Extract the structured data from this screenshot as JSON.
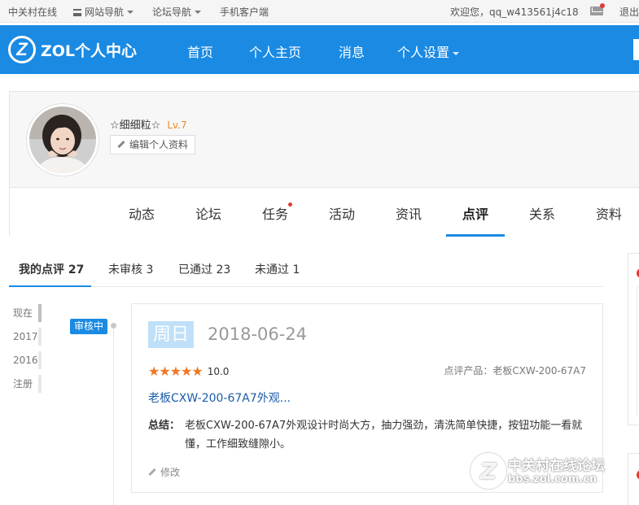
{
  "topbar": {
    "site": "中关村在线",
    "site_nav": "网站导航",
    "forum_nav": "论坛导航",
    "mobile": "手机客户端",
    "welcome": "欢迎您，qq_w413561j4c18",
    "logout": "退出"
  },
  "header": {
    "logo_letter": "Z",
    "logo_text": "ZOL个人中心",
    "nav": [
      "首页",
      "个人主页",
      "消息",
      "个人设置"
    ]
  },
  "profile": {
    "username": "☆细细粒☆",
    "level": "Lv.7",
    "edit_label": "编辑个人资料",
    "tabs": [
      "动态",
      "论坛",
      "任务",
      "活动",
      "资讯",
      "点评",
      "关系",
      "资料"
    ],
    "active_tab": "点评"
  },
  "review_tabs": [
    {
      "label": "我的点评",
      "count": "27"
    },
    {
      "label": "未审核",
      "count": "3"
    },
    {
      "label": "已通过",
      "count": "23"
    },
    {
      "label": "未通过",
      "count": "1"
    }
  ],
  "timeline": [
    "现在",
    "2017",
    "2016",
    "注册"
  ],
  "review": {
    "status": "审核中",
    "weekday": "周日",
    "date": "2018-06-24",
    "stars": "★★★★★",
    "score": "10.0",
    "product": "点评产品：老板CXW-200-67A7",
    "title": "老板CXW-200-67A7外观...",
    "summary_label": "总结：",
    "summary_text": "老板CXW-200-67A7外观设计时尚大方，抽力强劲，清洗简单快捷，按钮功能一看就懂，工作细致缝隙小。",
    "edit": "修改"
  },
  "watermark": {
    "line1": "中关村在线论坛",
    "line2": "bbs.zol.com.cn"
  },
  "colors": {
    "brand_blue": "#1a8ae3",
    "star_orange": "#f07824",
    "level_orange": "#f08a24"
  }
}
